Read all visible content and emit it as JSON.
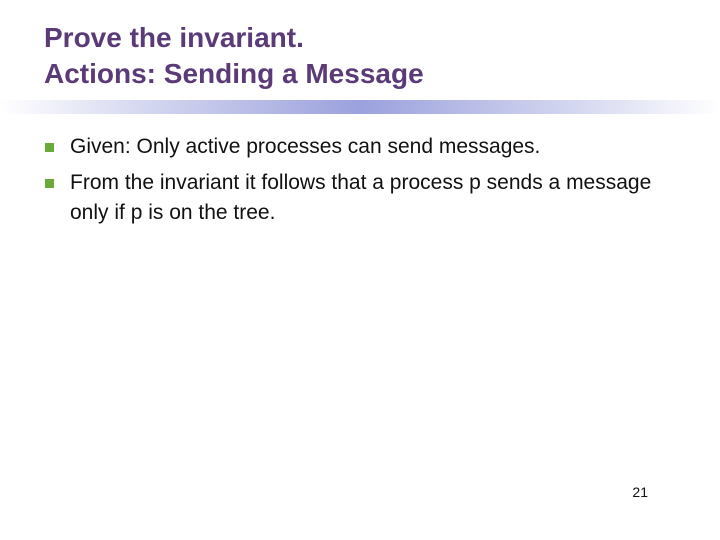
{
  "title": {
    "line1": "Prove the invariant.",
    "line2": "Actions: Sending a Message"
  },
  "bullets": [
    "Given: Only active processes can send messages.",
    "From the invariant it follows that a process p sends a message only if p is on the tree."
  ],
  "page_number": "21",
  "colors": {
    "title": "#5b3a78",
    "bullet_marker": "#6aaa3a",
    "divider": "#9ba1dd"
  }
}
